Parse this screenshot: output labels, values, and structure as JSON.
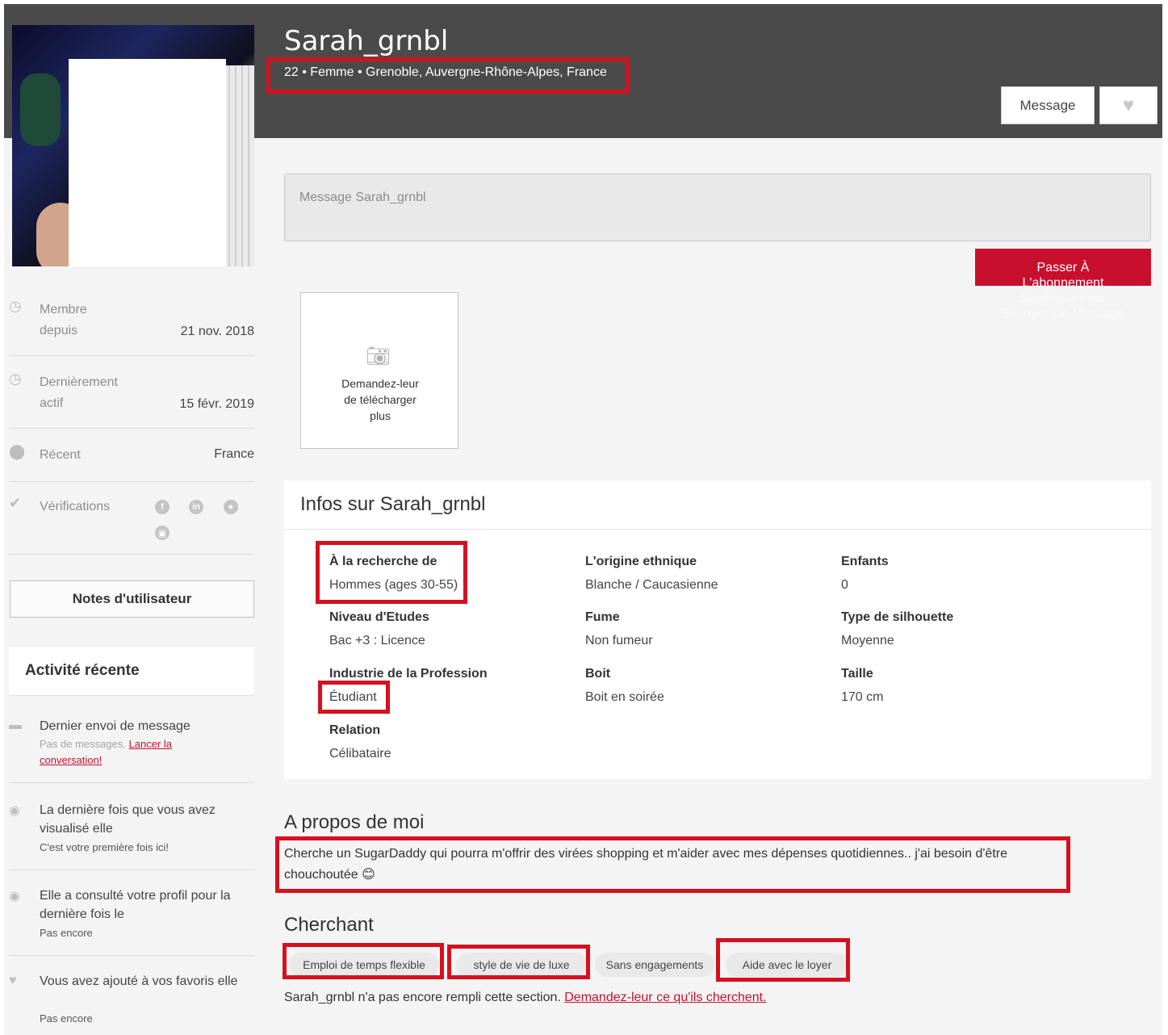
{
  "profile": {
    "username": "Sarah_grnbl",
    "summary": "22 • Femme • Grenoble, Auvergne-Rhône-Alpes, France",
    "message_button": "Message",
    "favorite_icon": "heart-icon"
  },
  "sidebar": {
    "member_since_label_1": "Membre",
    "member_since_label_2": "depuis",
    "member_since_value": "21 nov. 2018",
    "last_active_label_1": "Dernièrement",
    "last_active_label_2": "actif",
    "last_active_value": "15 févr. 2019",
    "recent_label": "Récent",
    "recent_value": "France",
    "verifications_label": "Vérifications",
    "notes_button": "Notes d'utilisateur"
  },
  "activity": {
    "title": "Activité récente",
    "items": [
      {
        "title": "Dernier envoi de message",
        "sub_muted": "Pas de messages. ",
        "sub_link_1": "Lancer la",
        "sub_link_2": "conversation!"
      },
      {
        "title": "La dernière fois que vous avez visualisé elle",
        "sub": "C'est votre première fois ici!"
      },
      {
        "title": "Elle a consulté votre profil pour la dernière fois le",
        "sub": "Pas encore"
      },
      {
        "title": "Vous avez ajouté à vos favoris elle",
        "sub": "Pas encore"
      }
    ]
  },
  "compose": {
    "placeholder": "Message Sarah_grnbl",
    "upgrade_line_1": "Passer À",
    "upgrade_line_2": "L'abonnement",
    "upgrade_line_3": "Supérieur Pour",
    "upgrade_line_4": "Envoyer Un Message"
  },
  "upload": {
    "line_1": "Demandez-leur",
    "line_2": "de télécharger",
    "line_3": "plus"
  },
  "info": {
    "title": "Infos sur Sarah_grnbl",
    "fields": [
      {
        "label": "À la recherche de",
        "value": "Hommes (ages 30-55)"
      },
      {
        "label": "L'origine ethnique",
        "value": "Blanche / Caucasienne"
      },
      {
        "label": "Enfants",
        "value": "0"
      },
      {
        "label": "Niveau d'Etudes",
        "value": "Bac +3 : Licence"
      },
      {
        "label": "Fume",
        "value": "Non fumeur"
      },
      {
        "label": "Type de silhouette",
        "value": "Moyenne"
      },
      {
        "label": "Industrie de la Profession",
        "value": "Étudiant"
      },
      {
        "label": "Boit",
        "value": "Boit en soirée"
      },
      {
        "label": "Taille",
        "value": "170 cm"
      },
      {
        "label": "Relation",
        "value": "Célibataire"
      }
    ]
  },
  "about": {
    "title": "A propos de moi",
    "text": "Cherche un SugarDaddy qui pourra m'offrir des virées shopping et m'aider avec mes dépenses quotidiennes.. j'ai besoin d'être chouchoutée 😊"
  },
  "seeking": {
    "title": "Cherchant",
    "tags": [
      "Emploi de temps flexible",
      "style de vie de luxe",
      "Sans engagements",
      "Aide avec le loyer"
    ],
    "note": "Sarah_grnbl n'a pas encore rempli cette section. ",
    "note_link": "Demandez-leur ce qu'ils cherchent."
  },
  "colors": {
    "accent": "#c8102e",
    "highlight": "#d5101f",
    "header_bg": "#4a4a4a"
  }
}
